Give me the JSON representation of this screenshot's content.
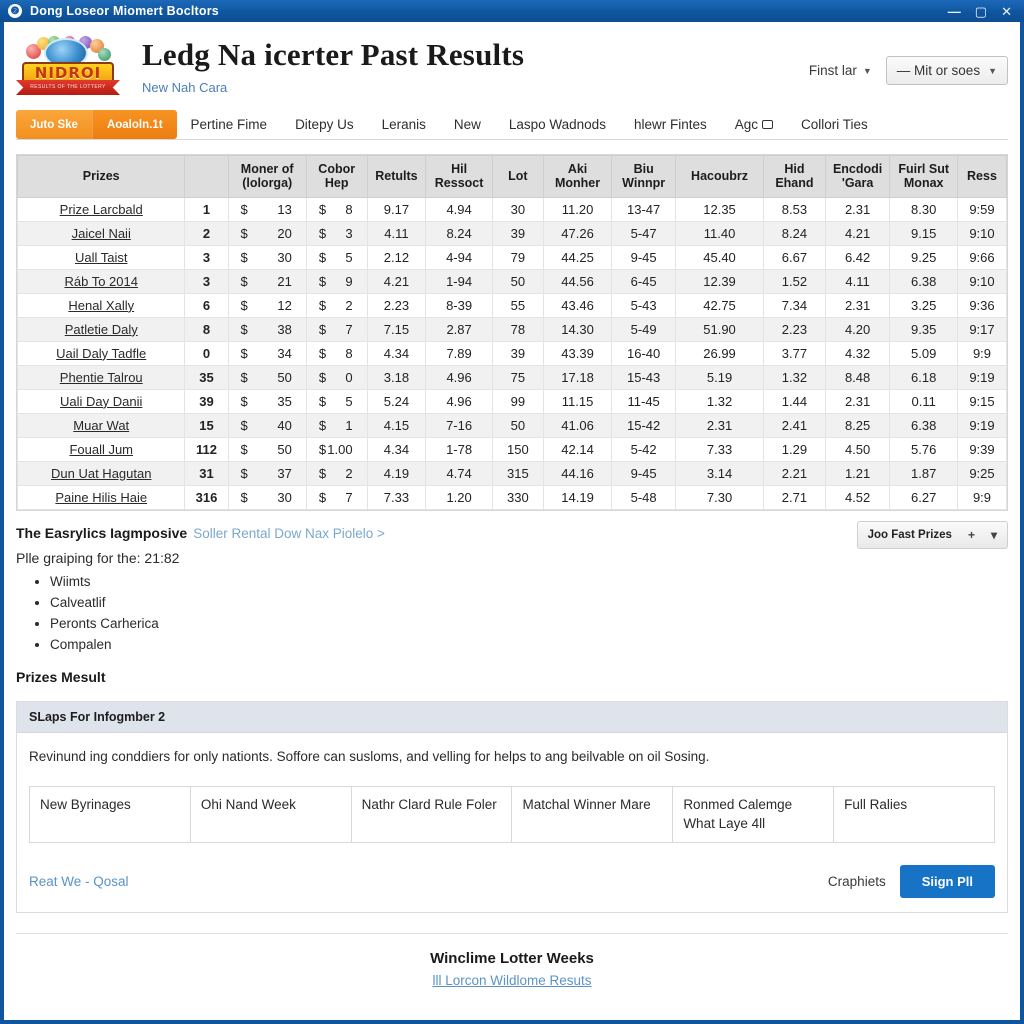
{
  "window": {
    "title": "Dong Loseor Miomert Bocltors",
    "icon": "app-circle-icon",
    "buttons": {
      "minimize": "—",
      "maximize": "▢",
      "close": "✕"
    }
  },
  "masthead": {
    "logo_word": "NIDROI",
    "logo_ribbon": "RESULTS OF THE LOTTERY",
    "title": "Ledg Na icerter Past Results",
    "subtitle": "New Nah Cara",
    "right_link": "Finst lar",
    "right_select": "— Mit or soes"
  },
  "nav": {
    "pills": [
      "Juto Ske",
      "Aoaloln.1t"
    ],
    "items": [
      {
        "label": "Pertine Fime",
        "icon": ""
      },
      {
        "label": "Ditepy Us",
        "icon": ""
      },
      {
        "label": "Leranis",
        "icon": ""
      },
      {
        "label": "New",
        "icon": ""
      },
      {
        "label": "Laspo Wadnods",
        "icon": ""
      },
      {
        "label": "hlewr Fintes",
        "icon": ""
      },
      {
        "label": "Agc",
        "icon": "box-icon"
      },
      {
        "label": "Collori Ties",
        "icon": ""
      }
    ]
  },
  "table": {
    "headers": [
      "Prizes",
      "",
      "Moner of (lolorga)",
      "Cobor Hep",
      "Retults",
      "Hil Ressoct",
      "Lot",
      "Aki Monher",
      "Biu Winnpr",
      "Hacoubrz",
      "Hid Ehand",
      "Encdodi 'Gara",
      "Fuirl Sut Monax",
      "Ress"
    ],
    "rows": [
      {
        "name": "Prize Larcbald",
        "rank": "1",
        "m1": "13",
        "m2": "8",
        "r1": "9.17",
        "r2": "4.94",
        "lot": "30",
        "akm": "11.20",
        "biu": "13-47",
        "hac": "12.35",
        "hid": "8.53",
        "enc": "2.31",
        "fui": "8.30",
        "ress": "9:59"
      },
      {
        "name": "Jaicel Naii",
        "rank": "2",
        "m1": "20",
        "m2": "3",
        "r1": "4.11",
        "r2": "8.24",
        "lot": "39",
        "akm": "47.26",
        "biu": "5-47",
        "hac": "11.40",
        "hid": "8.24",
        "enc": "4.21",
        "fui": "9.15",
        "ress": "9:10"
      },
      {
        "name": "Uall Taist",
        "rank": "3",
        "m1": "30",
        "m2": "5",
        "r1": "2.12",
        "r2": "4-94",
        "lot": "79",
        "akm": "44.25",
        "biu": "9-45",
        "hac": "45.40",
        "hid": "6.67",
        "enc": "6.42",
        "fui": "9.25",
        "ress": "9:66"
      },
      {
        "name": "Ráb To 2014",
        "rank": "3",
        "m1": "21",
        "m2": "9",
        "r1": "4.21",
        "r2": "1-94",
        "lot": "50",
        "akm": "44.56",
        "biu": "6-45",
        "hac": "12.39",
        "hid": "1.52",
        "enc": "4.11",
        "fui": "6.38",
        "ress": "9:10"
      },
      {
        "name": "Henal Xally",
        "rank": "6",
        "m1": "12",
        "m2": "2",
        "r1": "2.23",
        "r2": "8-39",
        "lot": "55",
        "akm": "43.46",
        "biu": "5-43",
        "hac": "42.75",
        "hid": "7.34",
        "enc": "2.31",
        "fui": "3.25",
        "ress": "9:36"
      },
      {
        "name": "Patletie Daly",
        "rank": "8",
        "m1": "38",
        "m2": "7",
        "r1": "7.15",
        "r2": "2.87",
        "lot": "78",
        "akm": "14.30",
        "biu": "5-49",
        "hac": "51.90",
        "hid": "2.23",
        "enc": "4.20",
        "fui": "9.35",
        "ress": "9:17"
      },
      {
        "name": "Uail Daly Tadfle",
        "rank": "0",
        "m1": "34",
        "m2": "8",
        "r1": "4.34",
        "r2": "7.89",
        "lot": "39",
        "akm": "43.39",
        "biu": "16-40",
        "hac": "26.99",
        "hid": "3.77",
        "enc": "4.32",
        "fui": "5.09",
        "ress": "9:9"
      },
      {
        "name": "Phentie Talrou",
        "rank": "35",
        "m1": "50",
        "m2": "0",
        "r1": "3.18",
        "r2": "4.96",
        "lot": "75",
        "akm": "17.18",
        "biu": "15-43",
        "hac": "5.19",
        "hid": "1.32",
        "enc": "8.48",
        "fui": "6.18",
        "ress": "9:19"
      },
      {
        "name": "Uali Day Danii",
        "rank": "39",
        "m1": "35",
        "m2": "5",
        "r1": "5.24",
        "r2": "4.96",
        "lot": "99",
        "akm": "11.15",
        "biu": "11-45",
        "hac": "1.32",
        "hid": "1.44",
        "enc": "2.31",
        "fui": "0.11",
        "ress": "9:15"
      },
      {
        "name": "Muar Wat",
        "rank": "15",
        "m1": "40",
        "m2": "1",
        "r1": "4.15",
        "r2": "7-16",
        "lot": "50",
        "akm": "41.06",
        "biu": "15-42",
        "hac": "2.31",
        "hid": "2.41",
        "enc": "8.25",
        "fui": "6.38",
        "ress": "9:19"
      },
      {
        "name": "Fouall Jum",
        "rank": "112",
        "m1": "50",
        "m2": "1.00",
        "r1": "4.34",
        "r2": "1-78",
        "lot": "150",
        "akm": "42.14",
        "biu": "5-42",
        "hac": "7.33",
        "hid": "1.29",
        "enc": "4.50",
        "fui": "5.76",
        "ress": "9:39"
      },
      {
        "name": "Dun Uat Hagutan",
        "rank": "31",
        "m1": "37",
        "m2": "2",
        "r1": "4.19",
        "r2": "4.74",
        "lot": "315",
        "akm": "44.16",
        "biu": "9-45",
        "hac": "3.14",
        "hid": "2.21",
        "enc": "1.21",
        "fui": "1.87",
        "ress": "9:25"
      },
      {
        "name": "Paine Hilis Haie",
        "rank": "316",
        "m1": "30",
        "m2": "7",
        "r1": "7.33",
        "r2": "1.20",
        "lot": "330",
        "akm": "14.19",
        "biu": "5-48",
        "hac": "7.30",
        "hid": "2.71",
        "enc": "4.52",
        "fui": "6.27",
        "ress": "9:9"
      }
    ],
    "currency": "$"
  },
  "mid": {
    "heading": "The Easrylics Iagmposive",
    "heading_link": "Soller Rental Dow Nax Piolelo >",
    "lead": "Plle graiping for the: 21:82",
    "bullets": [
      "Wiimts",
      "Calveatlif",
      "Peronts Carherica",
      "Compalen"
    ],
    "subheading": "Prizes Mesult",
    "button_label": "Joo Fast Prizes",
    "button_icons": {
      "add": "+",
      "dropdown": "▾"
    }
  },
  "panel": {
    "head": "SLaps For Infogmber 2",
    "description": "Revinund ing conddiers for only nationts. Soffore can susloms, and velling for helps to ang beilvable on oil Sosing.",
    "cards": [
      "New Byrinages",
      "Ohi Nand Week",
      "Nathr Clard Rule Foler",
      "Matchal Winner Mare",
      "Ronmed Calemge What Laye 4ll",
      "Full Ralies"
    ],
    "foot_link": "Reat We - Qosal",
    "foot_note": "Craphiets",
    "foot_button": "Siign Pll"
  },
  "footer": {
    "title": "Winclime Lotter Weeks",
    "link": "lll Lorcon Wildlome Resuts"
  }
}
